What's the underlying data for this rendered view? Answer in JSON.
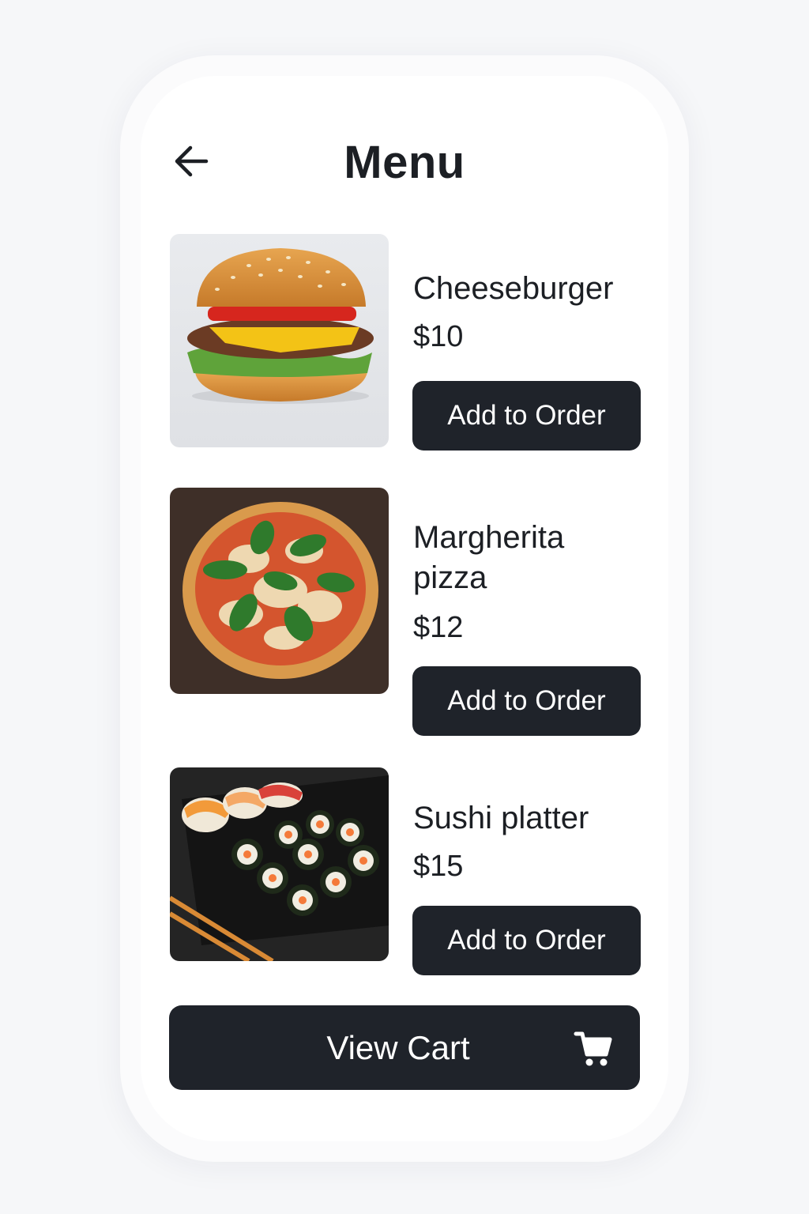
{
  "header": {
    "title": "Menu",
    "back_icon": "arrow-left-icon"
  },
  "menu": {
    "items": [
      {
        "name": "Cheeseburger",
        "price": "$10",
        "button_label": "Add to Order",
        "image": "cheeseburger-photo"
      },
      {
        "name": "Margherita pizza",
        "price": "$12",
        "button_label": "Add to Order",
        "image": "margherita-pizza-photo"
      },
      {
        "name": "Sushi platter",
        "price": "$15",
        "button_label": "Add to Order",
        "image": "sushi-platter-photo"
      }
    ]
  },
  "footer": {
    "cart_label": "View Cart",
    "cart_icon": "shopping-cart-icon"
  },
  "colors": {
    "button_background": "#1f232a",
    "button_text": "#ffffff",
    "text_primary": "#1c1f24",
    "page_background": "#f6f7f9"
  }
}
